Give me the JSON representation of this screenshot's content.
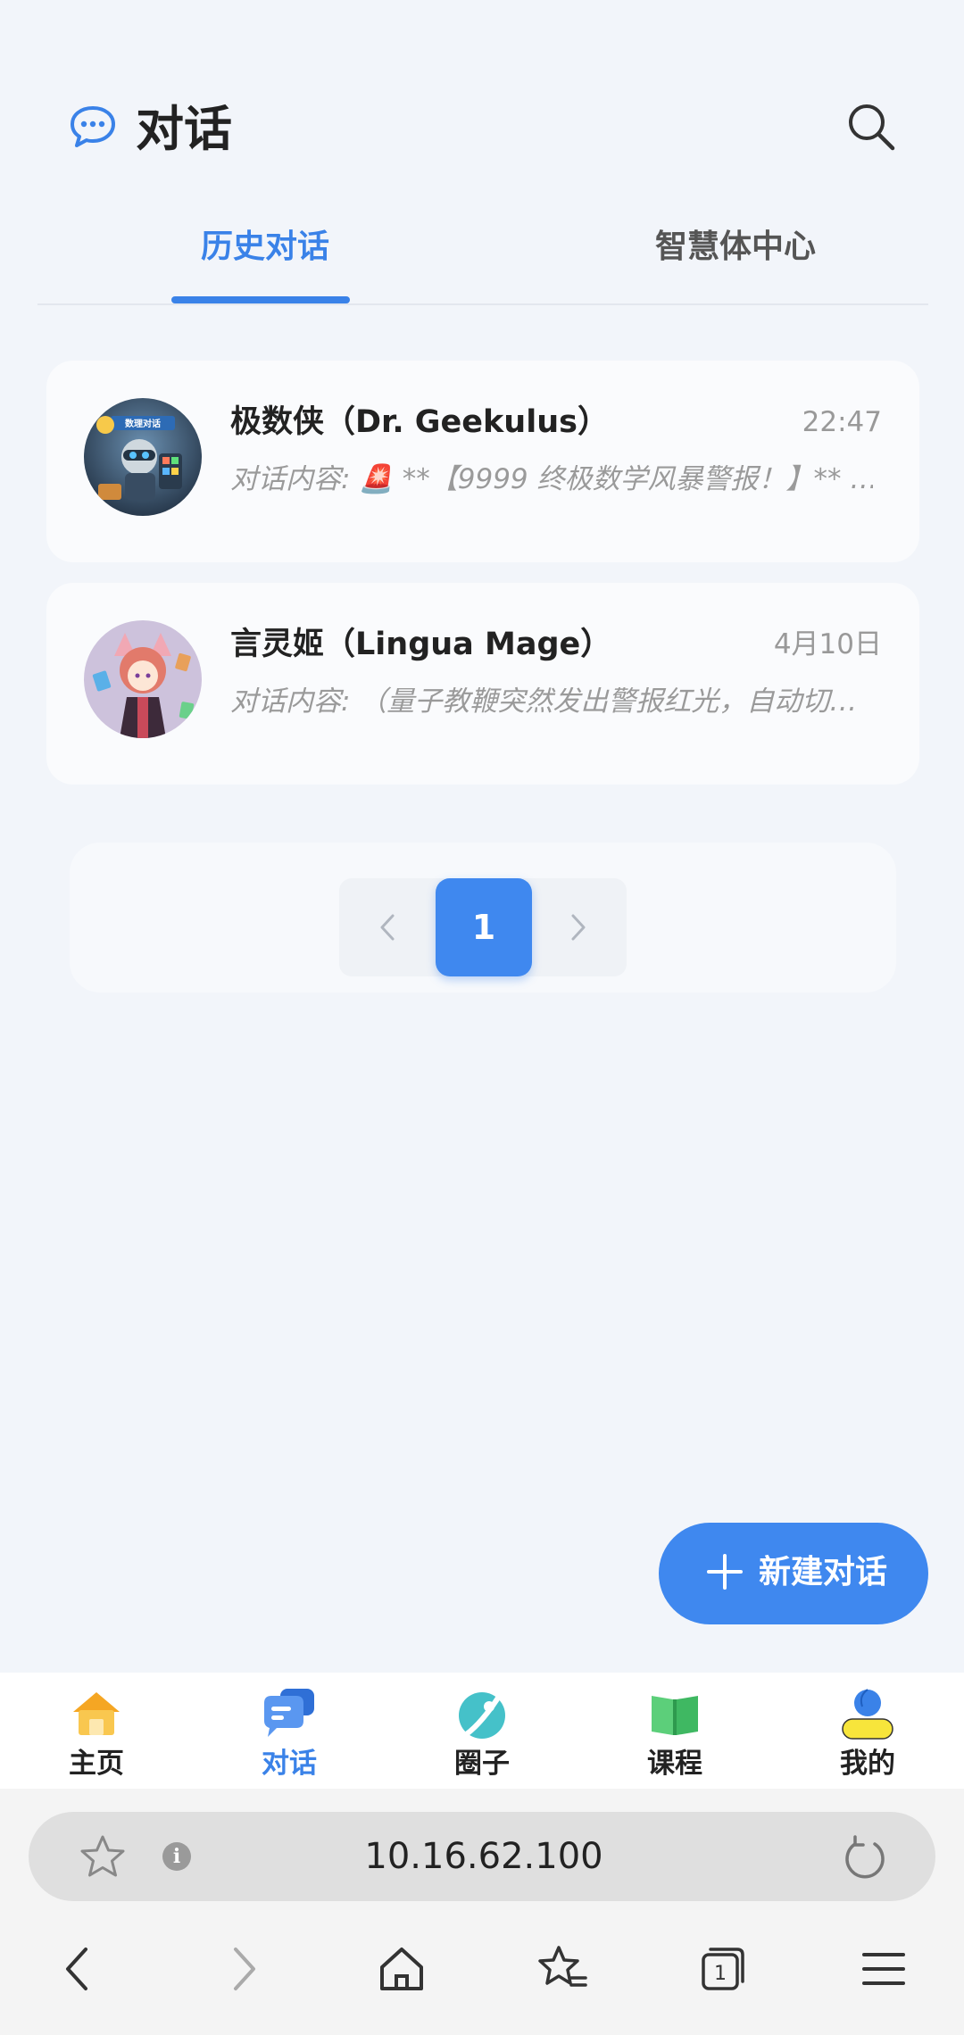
{
  "header": {
    "title": "对话",
    "logo_icon": "chat-bubble-icon",
    "search_icon": "search-icon"
  },
  "tabs": [
    {
      "label": "历史对话",
      "active": true
    },
    {
      "label": "智慧体中心",
      "active": false
    }
  ],
  "conversations": [
    {
      "name": "极数侠（Dr. Geekulus）",
      "time": "22:47",
      "preview": "对话内容: 🚨 **【9999 终极数学风暴警报！】** …",
      "avatar_text": "数理对话"
    },
    {
      "name": "言灵姬（Lingua Mage）",
      "time": "4月10日",
      "preview": "对话内容: （量子教鞭突然发出警报红光，自动切…"
    }
  ],
  "pagination": {
    "current_page": "1"
  },
  "fab": {
    "label": "新建对话"
  },
  "bottom_nav": [
    {
      "label": "主页",
      "icon": "home-icon",
      "active": false
    },
    {
      "label": "对话",
      "icon": "chat-icon",
      "active": true
    },
    {
      "label": "圈子",
      "icon": "circle-planet-icon",
      "active": false
    },
    {
      "label": "课程",
      "icon": "book-icon",
      "active": false
    },
    {
      "label": "我的",
      "icon": "profile-icon",
      "active": false
    }
  ],
  "browser": {
    "url": "10.16.62.100",
    "tab_count": "1"
  },
  "colors": {
    "accent": "#3f88ef",
    "background": "#f2f5fa"
  }
}
